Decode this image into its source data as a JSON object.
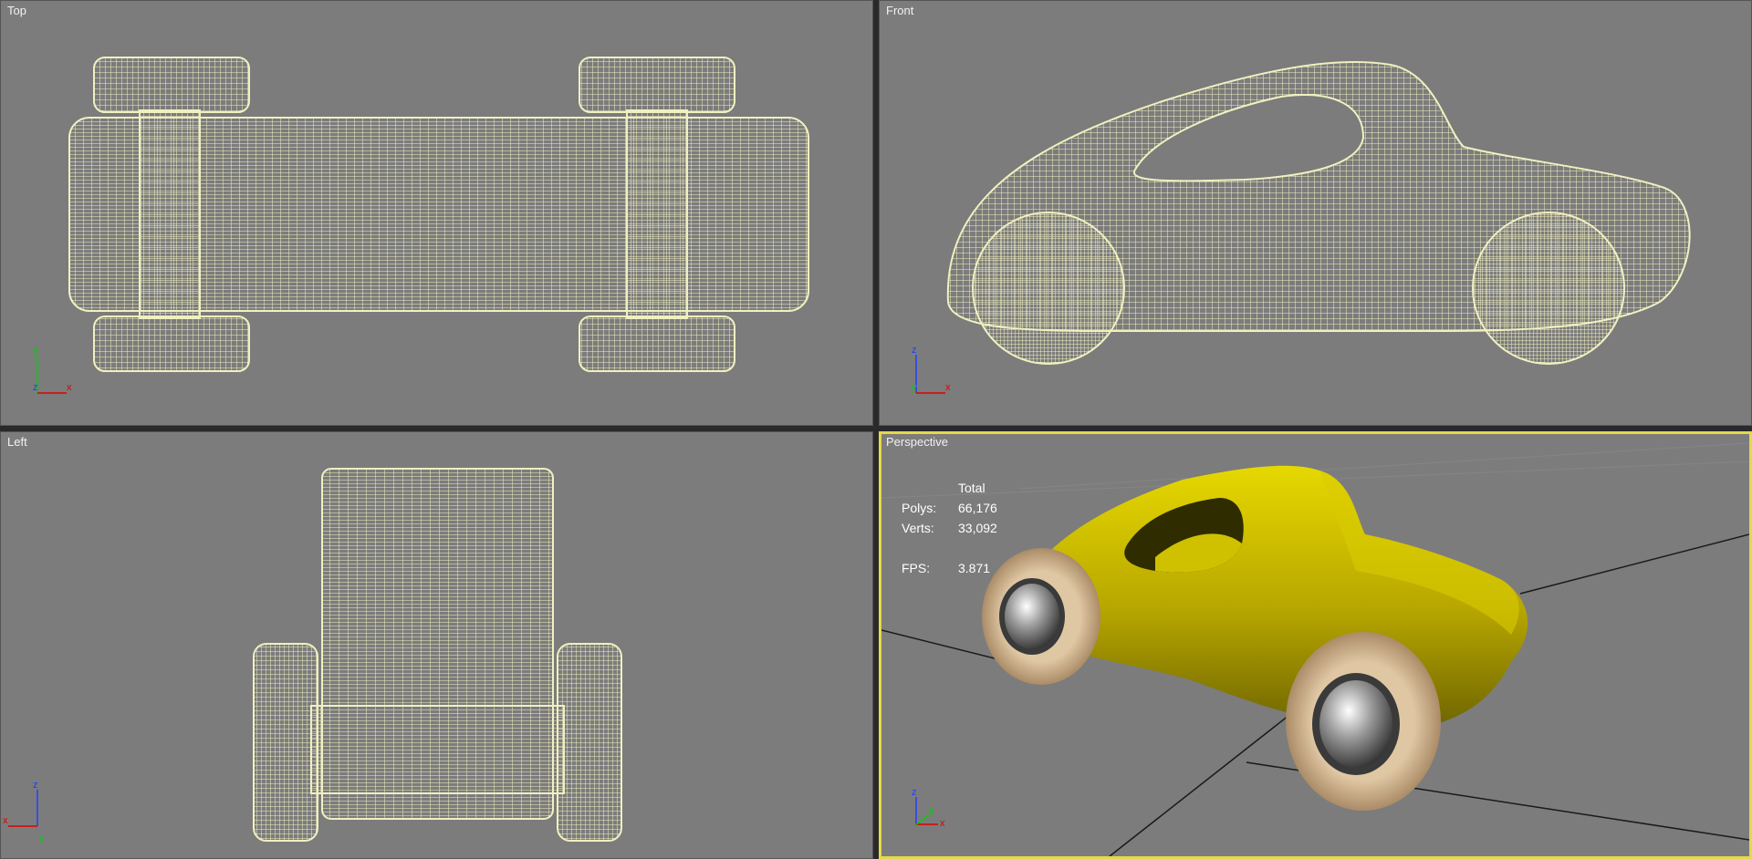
{
  "viewports": {
    "top": {
      "label": "Top"
    },
    "front": {
      "label": "Front"
    },
    "left": {
      "label": "Left"
    },
    "perspective": {
      "label": "Perspective"
    }
  },
  "stats": {
    "header": "Total",
    "polys_label": "Polys:",
    "polys_value": "66,176",
    "verts_label": "Verts:",
    "verts_value": "33,092",
    "fps_label": "FPS:",
    "fps_value": "3.871"
  },
  "axes": {
    "top": [
      "y",
      "z",
      "x"
    ],
    "front": [
      "z",
      "y",
      "x"
    ],
    "left": [
      "z",
      "x",
      "y"
    ],
    "perspective": [
      "z",
      "y",
      "x"
    ]
  },
  "colors": {
    "viewport_bg": "#7c7c7c",
    "wireframe": "#f0f0c0",
    "active_border": "#e3d94a",
    "car_body": "#d4c400",
    "wheel_wood": "#c9a882"
  }
}
